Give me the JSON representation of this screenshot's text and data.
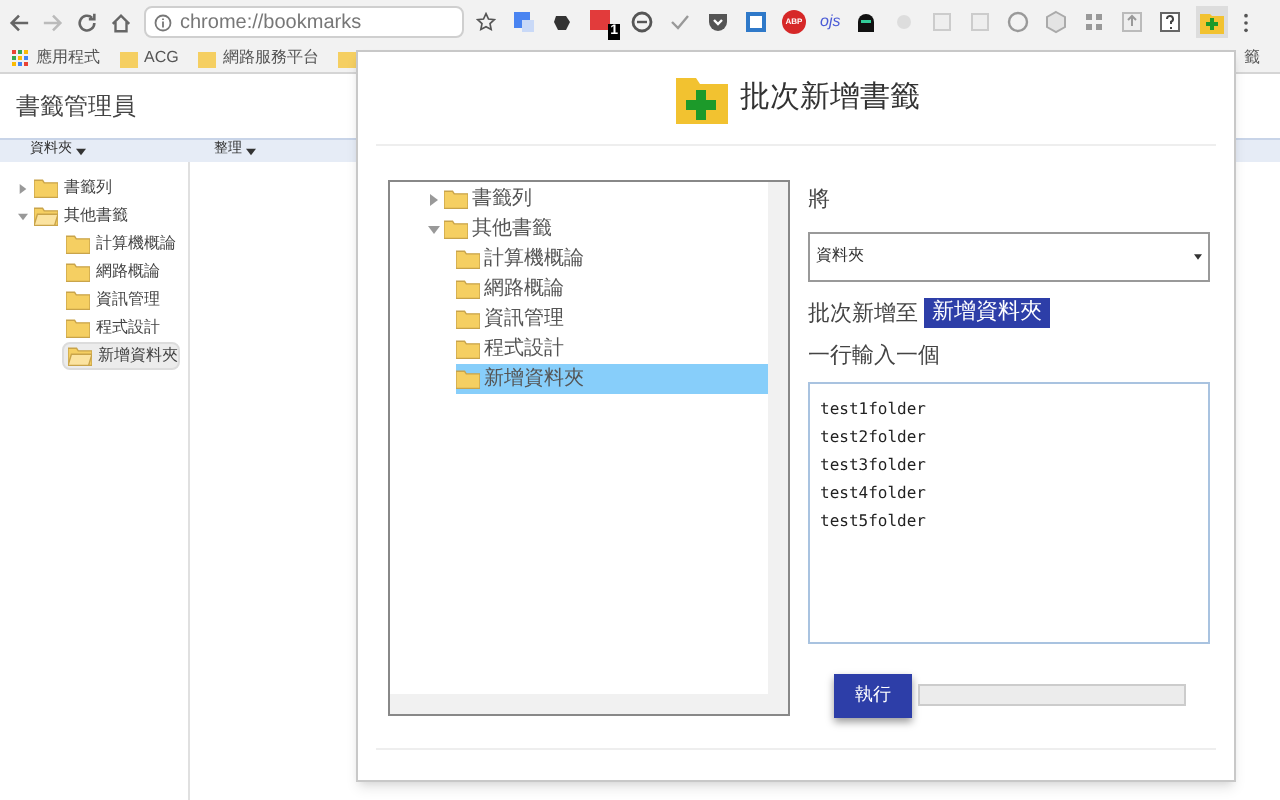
{
  "toolbar": {
    "address": "chrome://bookmarks",
    "badge": "1",
    "abp_label": "ABP",
    "ojs_label": "ojs"
  },
  "bookmarks_bar": [
    {
      "kind": "apps",
      "label": "應用程式"
    },
    {
      "kind": "folder",
      "label": "ACG"
    },
    {
      "kind": "folder",
      "label": "網路服務平台"
    },
    {
      "kind": "folder"
    },
    {
      "kind": "text",
      "label": "籤"
    }
  ],
  "manager": {
    "title": "書籤管理員",
    "menus": [
      "資料夾",
      "整理"
    ],
    "tree": [
      {
        "label": "書籤列",
        "expanded": false,
        "selected": false
      },
      {
        "label": "其他書籤",
        "expanded": true,
        "selected": false,
        "children": [
          {
            "label": "計算機概論",
            "selected": false
          },
          {
            "label": "網路概論",
            "selected": false
          },
          {
            "label": "資訊管理",
            "selected": false
          },
          {
            "label": "程式設計",
            "selected": false
          },
          {
            "label": "新增資料夾",
            "selected": true
          }
        ]
      }
    ]
  },
  "dialog": {
    "title": "批次新增書籤",
    "tree": [
      {
        "label": "書籤列",
        "expanded": false,
        "selected": false
      },
      {
        "label": "其他書籤",
        "expanded": true,
        "selected": false,
        "children": [
          {
            "label": "計算機概論",
            "selected": false
          },
          {
            "label": "網路概論",
            "selected": false
          },
          {
            "label": "資訊管理",
            "selected": false
          },
          {
            "label": "程式設計",
            "selected": false
          },
          {
            "label": "新增資料夾",
            "selected": true
          }
        ]
      }
    ],
    "target_label": "將",
    "select_value": "資料夾",
    "add_to_label": "批次新增至",
    "add_to_target": "新增資料夾",
    "input_label": "一行輸入一個",
    "input_value": "test1folder\ntest2folder\ntest3folder\ntest4folder\ntest5folder",
    "run_button": "執行",
    "progress": {
      "level": 0
    }
  }
}
